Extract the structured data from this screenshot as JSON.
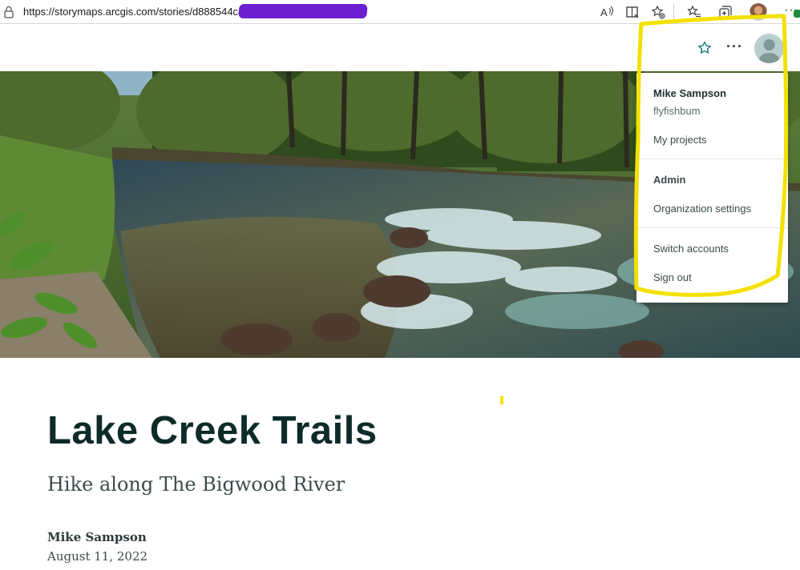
{
  "browser": {
    "url_text": "https://storymaps.arcgis.com/stories/d888544c4",
    "icons": [
      "lock-icon",
      "read-aloud-icon",
      "reader-view-icon",
      "add-favorite-icon",
      "favorites-icon",
      "collections-icon",
      "profile-icon",
      "more-icon"
    ]
  },
  "header": {
    "icons": [
      "star-icon",
      "more-options-icon",
      "account-avatar-icon"
    ]
  },
  "account_menu": {
    "name": "Mike Sampson",
    "username": "flyfishbum",
    "my_projects": "My projects",
    "admin_heading": "Admin",
    "org_settings": "Organization settings",
    "switch_accounts": "Switch accounts",
    "sign_out": "Sign out"
  },
  "story": {
    "title": "Lake Creek Trails",
    "subtitle": "Hike along The Bigwood River",
    "author": "Mike Sampson",
    "date": "August 11, 2022"
  },
  "colors": {
    "highlight": "#f2e100",
    "redaction": "#6a1fd1",
    "title_text": "#0d2b28"
  }
}
